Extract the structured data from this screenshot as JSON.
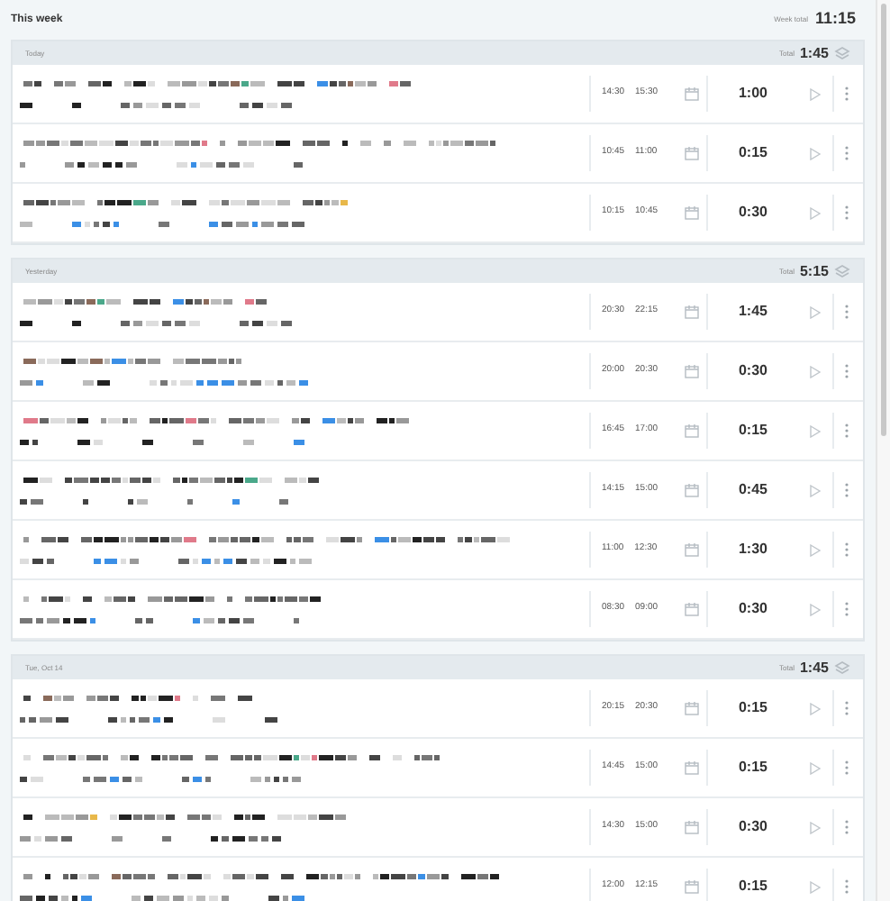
{
  "title": "This week",
  "week_total": {
    "label": "Week total",
    "value": "11:15"
  },
  "days": [
    {
      "label": "Today",
      "total_label": "Total",
      "total": "1:45",
      "entries": [
        {
          "start": "14:30",
          "end": "15:30",
          "duration": "1:00"
        },
        {
          "start": "10:45",
          "end": "11:00",
          "duration": "0:15"
        },
        {
          "start": "10:15",
          "end": "10:45",
          "duration": "0:30"
        }
      ]
    },
    {
      "label": "Yesterday",
      "total_label": "Total",
      "total": "5:15",
      "entries": [
        {
          "start": "20:30",
          "end": "22:15",
          "duration": "1:45"
        },
        {
          "start": "20:00",
          "end": "20:30",
          "duration": "0:30"
        },
        {
          "start": "16:45",
          "end": "17:00",
          "duration": "0:15"
        },
        {
          "start": "14:15",
          "end": "15:00",
          "duration": "0:45"
        },
        {
          "start": "11:00",
          "end": "12:30",
          "duration": "1:30"
        },
        {
          "start": "08:30",
          "end": "09:00",
          "duration": "0:30"
        }
      ]
    },
    {
      "label": "Tue, Oct 14",
      "total_label": "Total",
      "total": "1:45",
      "entries": [
        {
          "start": "20:15",
          "end": "20:30",
          "duration": "0:15"
        },
        {
          "start": "14:45",
          "end": "15:00",
          "duration": "0:15"
        },
        {
          "start": "14:30",
          "end": "15:00",
          "duration": "0:30"
        },
        {
          "start": "12:00",
          "end": "12:15",
          "duration": "0:15"
        }
      ]
    }
  ]
}
